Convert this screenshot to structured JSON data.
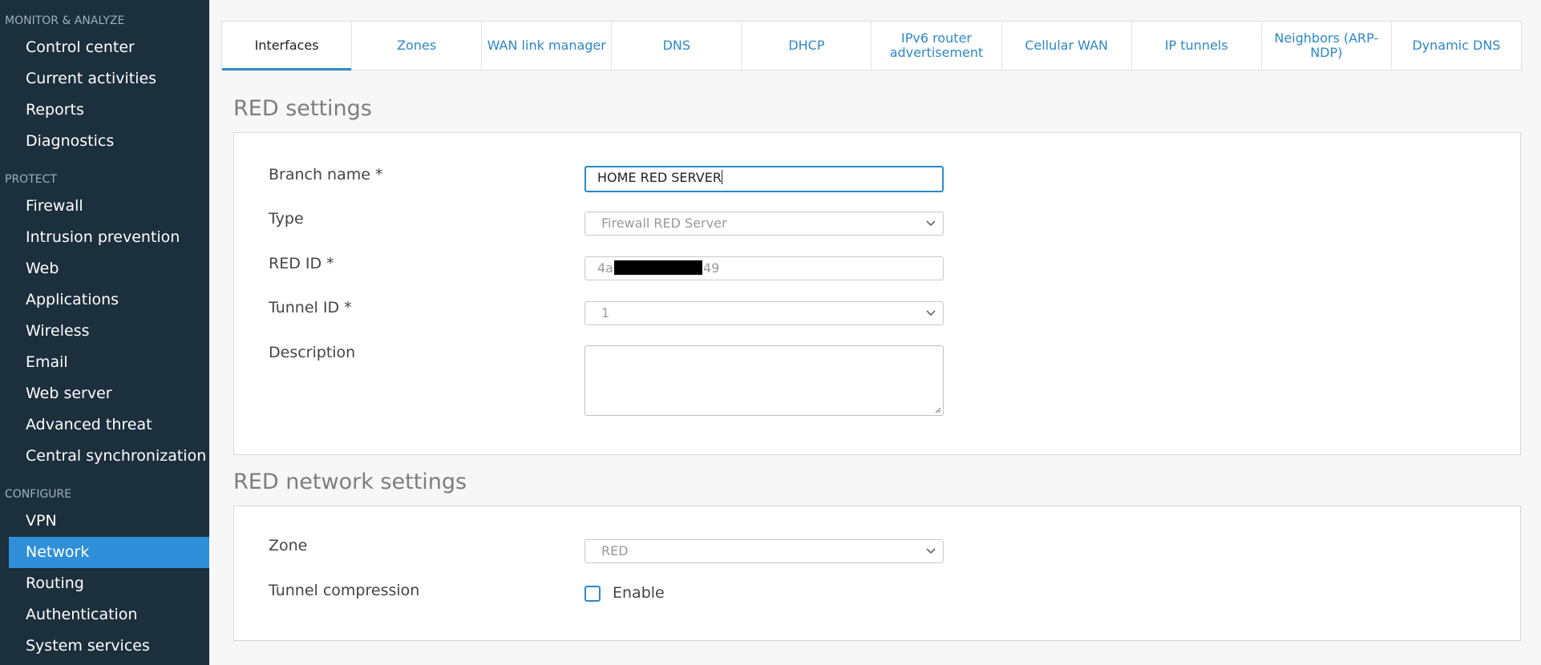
{
  "sidebar": {
    "sections": [
      {
        "heading": "MONITOR & ANALYZE",
        "items": [
          "Control center",
          "Current activities",
          "Reports",
          "Diagnostics"
        ]
      },
      {
        "heading": "PROTECT",
        "items": [
          "Firewall",
          "Intrusion prevention",
          "Web",
          "Applications",
          "Wireless",
          "Email",
          "Web server",
          "Advanced threat",
          "Central synchronization"
        ]
      },
      {
        "heading": "CONFIGURE",
        "items": [
          "VPN",
          "Network",
          "Routing",
          "Authentication",
          "System services"
        ]
      }
    ],
    "active_item": "Network"
  },
  "tabs": [
    {
      "label": "Interfaces",
      "active": true
    },
    {
      "label": "Zones"
    },
    {
      "label": "WAN link manager"
    },
    {
      "label": "DNS"
    },
    {
      "label": "DHCP"
    },
    {
      "label": "IPv6 router advertisement"
    },
    {
      "label": "Cellular WAN"
    },
    {
      "label": "IP tunnels"
    },
    {
      "label": "Neighbors (ARP-NDP)"
    },
    {
      "label": "Dynamic DNS"
    }
  ],
  "red_settings": {
    "title": "RED settings",
    "branch_name": {
      "label": "Branch name *",
      "value": "HOME RED SERVER"
    },
    "type": {
      "label": "Type",
      "value": "Firewall RED Server"
    },
    "red_id": {
      "label": "RED ID *",
      "prefix": "4a",
      "suffix": "49"
    },
    "tunnel_id": {
      "label": "Tunnel ID *",
      "value": "1"
    },
    "description": {
      "label": "Description",
      "value": ""
    }
  },
  "red_network": {
    "title": "RED network settings",
    "zone": {
      "label": "Zone",
      "value": "RED"
    },
    "tunnel_compression": {
      "label": "Tunnel compression",
      "checkbox_label": "Enable",
      "checked": false
    }
  },
  "colors": {
    "sidebar_bg": "#1c2f3d",
    "accent": "#2f8fd8",
    "link": "#2c88c9"
  }
}
